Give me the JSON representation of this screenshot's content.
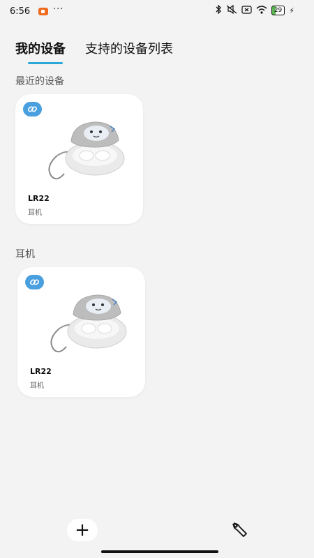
{
  "status_bar": {
    "time": "6:56",
    "battery": "29",
    "icons": [
      "recording-icon",
      "more-dots-icon",
      "bluetooth-icon",
      "mute-icon",
      "sim-icon",
      "wifi-icon",
      "battery-icon",
      "charging-icon"
    ]
  },
  "tabs": [
    {
      "label": "我的设备",
      "active": true
    },
    {
      "label": "支持的设备列表",
      "active": false
    }
  ],
  "sections": [
    {
      "title": "最近的设备",
      "devices": [
        {
          "name": "LR22",
          "type": "耳机",
          "icon": "link-icon"
        }
      ]
    },
    {
      "title": "耳机",
      "devices": [
        {
          "name": "LR22",
          "type": "耳机",
          "icon": "link-icon"
        }
      ]
    }
  ],
  "bottom_bar": {
    "add_icon": "plus-icon",
    "tool_icon": "wrench-icon"
  },
  "colors": {
    "accent": "#2aa9d8",
    "link_badge": "#4a9fdf",
    "background": "#f3f3f3",
    "card": "#ffffff",
    "recording": "#f06a1d"
  }
}
